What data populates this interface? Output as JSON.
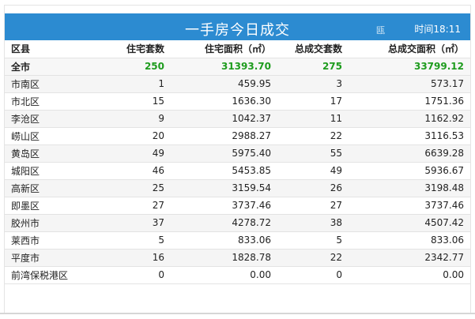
{
  "title": "一手房今日成交",
  "time_label": "时间18:11",
  "watermark": "瓯",
  "headers": [
    "区县",
    "住宅套数",
    "住宅面积（㎡）",
    "总成交套数",
    "总成交面积（㎡）"
  ],
  "total": [
    "全市",
    "250",
    "31393.70",
    "275",
    "33799.12"
  ],
  "rows": [
    [
      "市南区",
      "1",
      "459.95",
      "3",
      "573.17"
    ],
    [
      "市北区",
      "15",
      "1636.30",
      "17",
      "1751.36"
    ],
    [
      "李沧区",
      "9",
      "1042.37",
      "11",
      "1162.92"
    ],
    [
      "崂山区",
      "20",
      "2988.27",
      "22",
      "3116.53"
    ],
    [
      "黄岛区",
      "49",
      "5975.40",
      "55",
      "6639.28"
    ],
    [
      "城阳区",
      "46",
      "5453.85",
      "49",
      "5936.67"
    ],
    [
      "高新区",
      "25",
      "3159.54",
      "26",
      "3198.48"
    ],
    [
      "即墨区",
      "27",
      "3737.46",
      "27",
      "3737.46"
    ],
    [
      "胶州市",
      "37",
      "4278.72",
      "38",
      "4507.42"
    ],
    [
      "莱西市",
      "5",
      "833.06",
      "5",
      "833.06"
    ],
    [
      "平度市",
      "16",
      "1828.78",
      "22",
      "2342.77"
    ],
    [
      "前湾保税港区",
      "0",
      "0.00",
      "0",
      "0.00"
    ]
  ]
}
